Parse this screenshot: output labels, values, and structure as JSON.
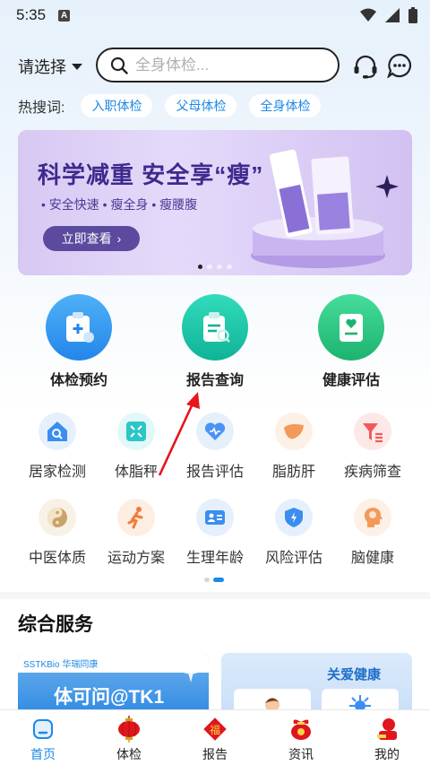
{
  "status": {
    "time": "5:35",
    "notif_glyph": "A"
  },
  "header": {
    "region_label": "请选择",
    "search_placeholder": "全身体检...",
    "icons": [
      "headset-icon",
      "message-icon"
    ]
  },
  "hot": {
    "label": "热搜词:",
    "chips": [
      "入职体检",
      "父母体检",
      "全身体检"
    ]
  },
  "banner": {
    "title": "科学减重  安全享“瘦”",
    "subtitle": "• 安全快速  • 瘦全身  • 瘦腰腹",
    "button": "立即查看",
    "slides": 4,
    "active_slide": 1
  },
  "main_features": [
    {
      "label": "体检预约",
      "color": "#2f9bf0",
      "icon": "appointment-icon"
    },
    {
      "label": "报告查询",
      "color": "#1cc7a8",
      "icon": "report-search-icon"
    },
    {
      "label": "健康评估",
      "color": "#2ec987",
      "icon": "health-assess-icon"
    }
  ],
  "sub_features": [
    {
      "label": "居家检测",
      "color": "#3b8ef0",
      "bg": "#e6f0fc",
      "icon": "home-test-icon"
    },
    {
      "label": "体脂秤",
      "color": "#2cc6c6",
      "bg": "#e2f7f7",
      "icon": "scale-icon"
    },
    {
      "label": "报告评估",
      "color": "#4a93f2",
      "bg": "#e6f0fc",
      "icon": "heart-report-icon"
    },
    {
      "label": "脂肪肝",
      "color": "#f29a5a",
      "bg": "#fdf0e6",
      "icon": "liver-icon"
    },
    {
      "label": "疾病筛查",
      "color": "#f25a5a",
      "bg": "#fde8e8",
      "icon": "filter-icon"
    },
    {
      "label": "中医体质",
      "color": "#c8a36a",
      "bg": "#f8f1e6",
      "icon": "taiji-icon"
    },
    {
      "label": "运动方案",
      "color": "#f27a3a",
      "bg": "#fdeee4",
      "icon": "running-icon"
    },
    {
      "label": "生理年龄",
      "color": "#3b8ef0",
      "bg": "#e6f0fc",
      "icon": "id-card-icon"
    },
    {
      "label": "风险评估",
      "color": "#3b8ef0",
      "bg": "#e6f0fc",
      "icon": "shield-icon"
    },
    {
      "label": "脑健康",
      "color": "#f29a5a",
      "bg": "#fdf0e6",
      "icon": "brain-head-icon"
    }
  ],
  "section": {
    "title": "综合服务"
  },
  "cards": {
    "left_brand": "SSTKBio 华瑞同康",
    "left_title": "体可问@TK1",
    "right_title": "关爱健康"
  },
  "bottom_nav": [
    {
      "label": "首页",
      "icon": "home-icon",
      "active": true
    },
    {
      "label": "体检",
      "icon": "lantern-icon",
      "active": false
    },
    {
      "label": "报告",
      "icon": "fu-icon",
      "active": false
    },
    {
      "label": "资讯",
      "icon": "news-icon",
      "active": false
    },
    {
      "label": "我的",
      "icon": "profile-icon",
      "active": false
    }
  ]
}
